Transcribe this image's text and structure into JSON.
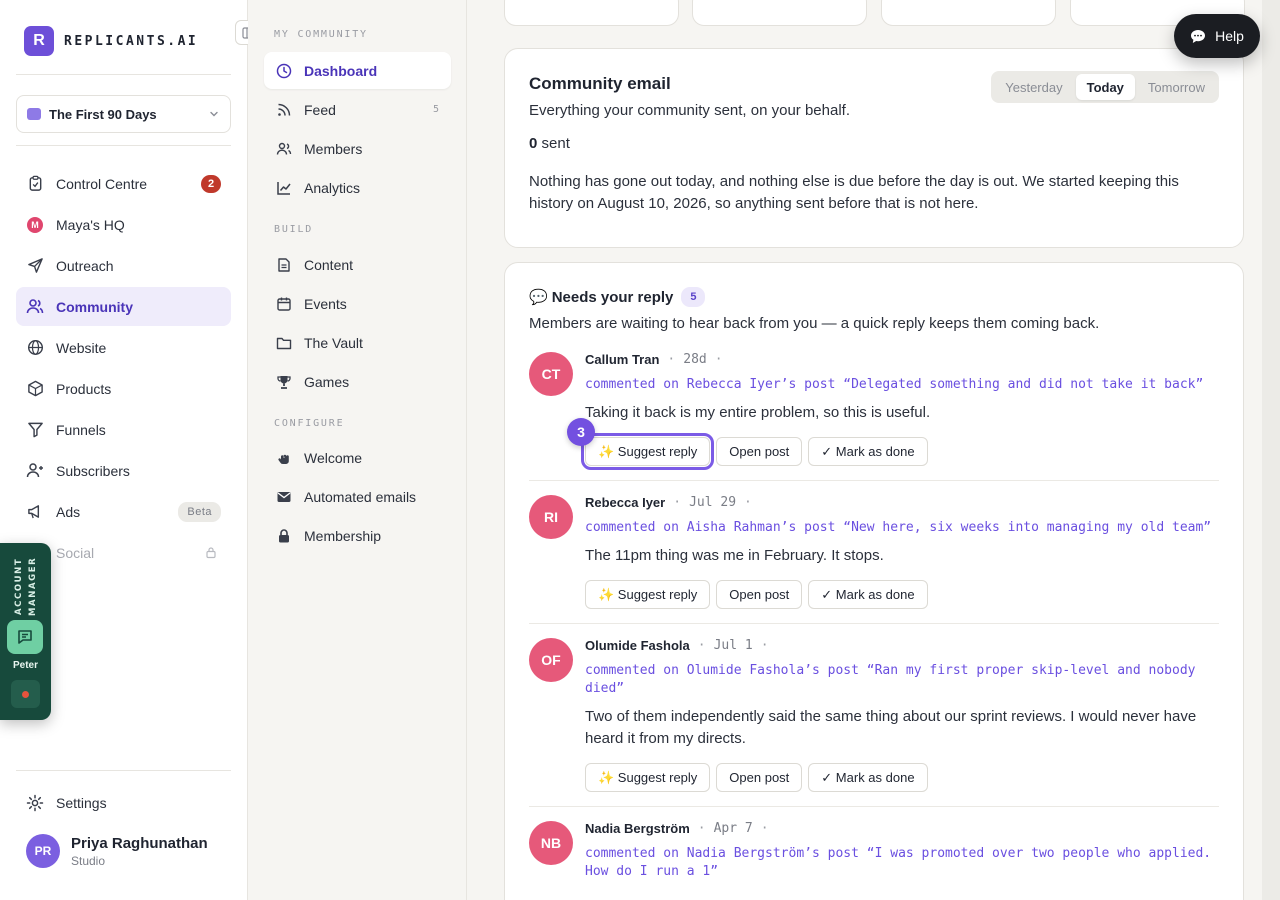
{
  "brand": {
    "logo_letter": "R",
    "name": "REPLICANTS.AI"
  },
  "workspace": {
    "name": "The First 90 Days"
  },
  "sidebar": {
    "items": [
      {
        "label": "Control Centre",
        "icon": "clipboard-icon",
        "badge": "2"
      },
      {
        "label": "Maya's HQ",
        "icon": "maya-logo-icon",
        "logo_letter": "M"
      },
      {
        "label": "Outreach",
        "icon": "send-icon"
      },
      {
        "label": "Community",
        "icon": "users-icon",
        "active": true
      },
      {
        "label": "Website",
        "icon": "globe-icon"
      },
      {
        "label": "Products",
        "icon": "box-icon"
      },
      {
        "label": "Funnels",
        "icon": "filter-icon"
      },
      {
        "label": "Subscribers",
        "icon": "subscribers-icon"
      },
      {
        "label": "Ads",
        "icon": "megaphone-icon",
        "badge": "Beta"
      },
      {
        "label": "Social",
        "icon": "lock-icon",
        "disabled": true
      }
    ],
    "settings_label": "Settings",
    "user": {
      "initials": "PR",
      "name": "Priya Raghunathan",
      "plan": "Studio"
    }
  },
  "account_manager": {
    "label": "ACCOUNT MANAGER",
    "name": "Peter"
  },
  "subnav": {
    "sections": [
      {
        "title": "MY COMMUNITY",
        "items": [
          {
            "label": "Dashboard",
            "icon": "clock-icon",
            "active": true
          },
          {
            "label": "Feed",
            "icon": "rss-icon",
            "count": "5"
          },
          {
            "label": "Members",
            "icon": "members-icon"
          },
          {
            "label": "Analytics",
            "icon": "chart-icon"
          }
        ]
      },
      {
        "title": "BUILD",
        "items": [
          {
            "label": "Content",
            "icon": "content-icon"
          },
          {
            "label": "Events",
            "icon": "calendar-icon"
          },
          {
            "label": "The Vault",
            "icon": "folder-icon"
          },
          {
            "label": "Games",
            "icon": "trophy-icon"
          }
        ]
      },
      {
        "title": "CONFIGURE",
        "items": [
          {
            "label": "Welcome",
            "icon": "welcome-icon"
          },
          {
            "label": "Automated emails",
            "icon": "mail-icon"
          },
          {
            "label": "Membership",
            "icon": "lock-icon"
          }
        ]
      }
    ]
  },
  "community_email": {
    "title": "Community email",
    "subtitle": "Everything your community sent, on your behalf.",
    "tabs": [
      "Yesterday",
      "Today",
      "Tomorrow"
    ],
    "active_tab": "Today",
    "sent_count": "0",
    "sent_label": "sent",
    "body": "Nothing has gone out today, and nothing else is due before the day is out. We started keeping this history on August 10, 2026, so anything sent before that is not here."
  },
  "needs_reply": {
    "emoji": "💬",
    "title": "Needs your reply",
    "count": "5",
    "subtitle": "Members are waiting to hear back from you — a quick reply keeps them coming back.",
    "buttons": {
      "suggest": "✨ Suggest reply",
      "open": "Open post",
      "done": "✓ Mark as done"
    },
    "step_badge": "3",
    "entries": [
      {
        "initials": "CT",
        "name": "Callum Tran",
        "date": "28d",
        "context": "commented on Rebecca Iyer’s post “Delegated something and did not take it back”",
        "comment": "Taking it back is my entire problem, so this is useful."
      },
      {
        "initials": "RI",
        "name": "Rebecca Iyer",
        "date": "Jul 29",
        "context": "commented on Aisha Rahman’s post “New here, six weeks into managing my old team”",
        "comment": "The 11pm thing was me in February. It stops."
      },
      {
        "initials": "OF",
        "name": "Olumide Fashola",
        "date": "Jul 1",
        "context": "commented on Olumide Fashola’s post “Ran my first proper skip-level and nobody died”",
        "comment": "Two of them independently said the same thing about our sprint reviews. I would never have heard it from my directs."
      },
      {
        "initials": "NB",
        "name": "Nadia Bergström",
        "date": "Apr 7",
        "context": "commented on Nadia Bergström’s post “I was promoted over two people who applied. How do I run a 1”",
        "comment": ""
      }
    ]
  },
  "help": {
    "label": "Help"
  },
  "colors": {
    "accent": "#6d4fd8",
    "link": "#6a4fe0",
    "avatar": "#e6597a",
    "badge_red": "#c0392b"
  }
}
